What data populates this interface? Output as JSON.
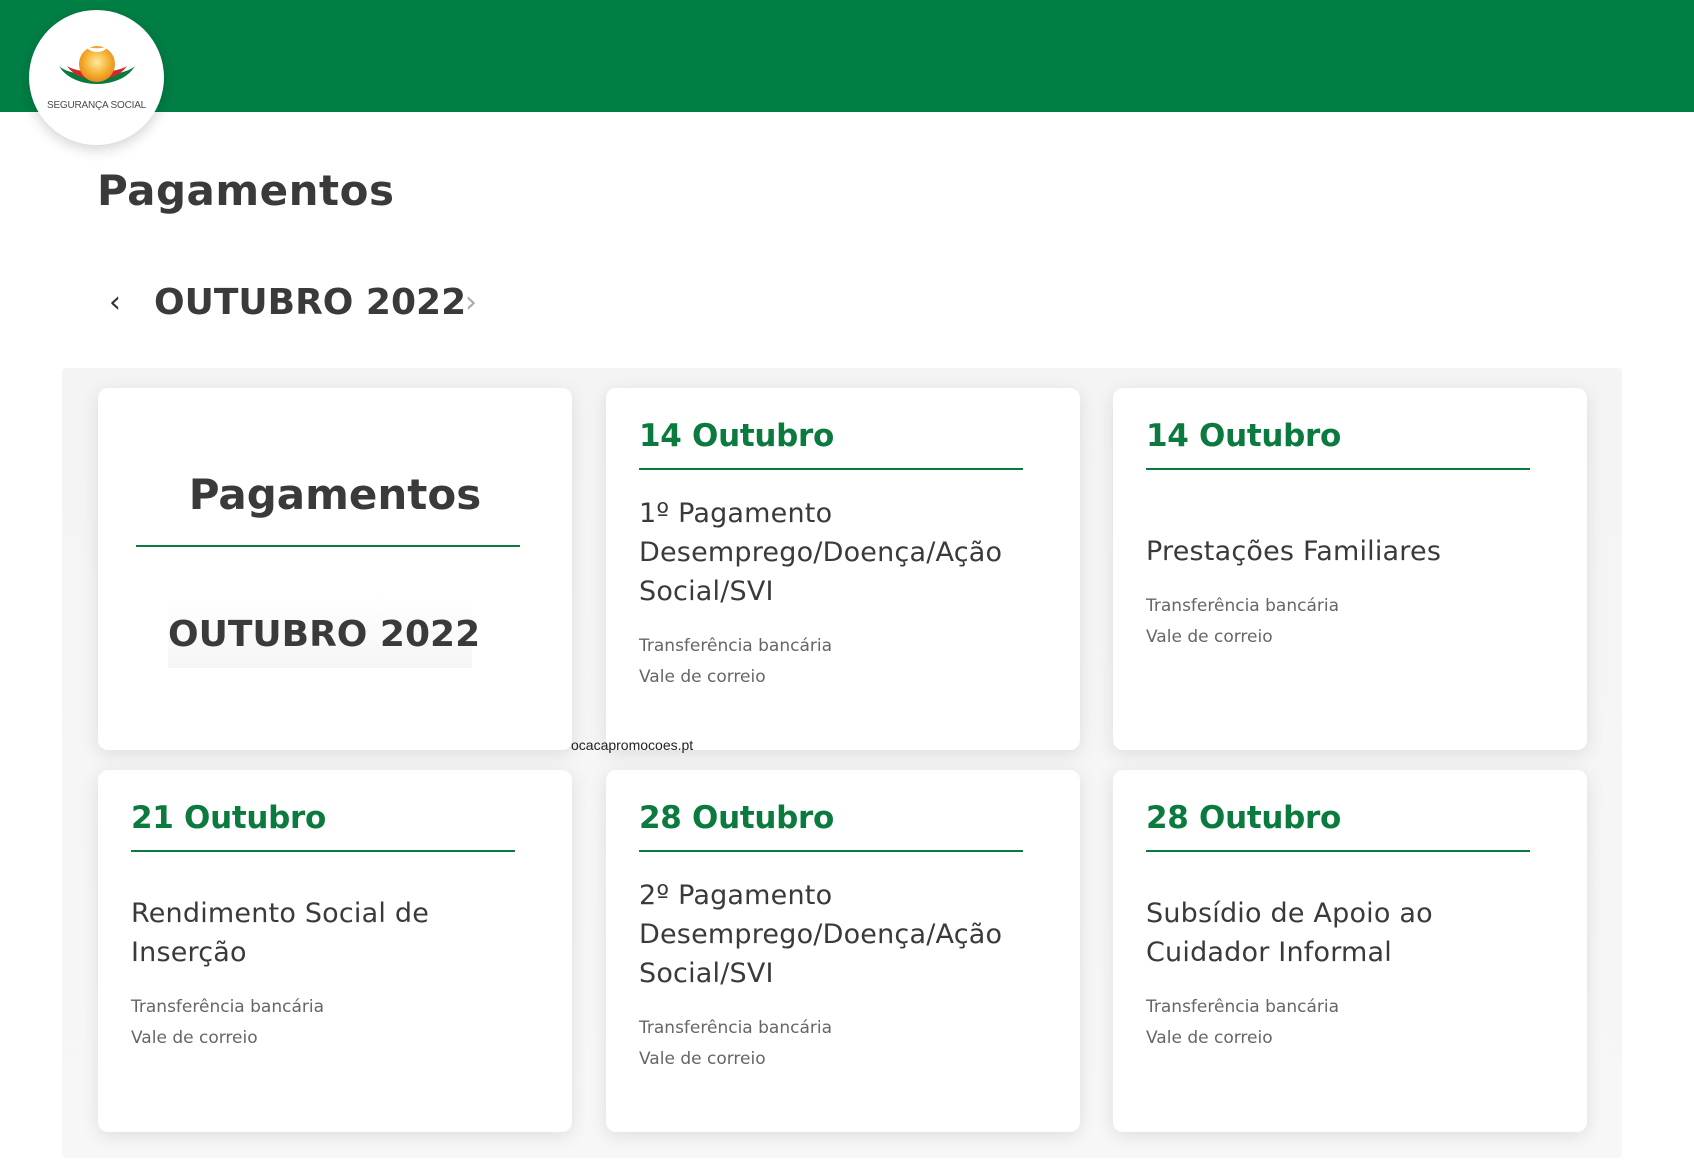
{
  "header": {
    "logo_text": "SEGURANÇA SOCIAL",
    "brand_color": "#007f45"
  },
  "page": {
    "title": "Pagamentos"
  },
  "month_nav": {
    "label": "OUTUBRO 2022",
    "prev_icon": "chevron-left-icon",
    "next_icon": "chevron-right-icon"
  },
  "intro_card": {
    "title": "Pagamentos",
    "month": "OUTUBRO 2022"
  },
  "cards": [
    {
      "date": "14 Outubro",
      "title": "1º Pagamento Desemprego/Doença/Ação Social/SVI",
      "methods": [
        "Transferência bancária",
        "Vale de correio"
      ]
    },
    {
      "date": "14 Outubro",
      "title": "Prestações Familiares",
      "methods": [
        "Transferência bancária",
        "Vale de correio"
      ]
    },
    {
      "date": "21 Outubro",
      "title": "Rendimento Social de Inserção",
      "methods": [
        "Transferência bancária",
        "Vale de correio"
      ]
    },
    {
      "date": "28 Outubro",
      "title": "2º Pagamento Desemprego/Doença/Ação Social/SVI",
      "methods": [
        "Transferência bancária",
        "Vale de correio"
      ]
    },
    {
      "date": "28 Outubro",
      "title": "Subsídio de Apoio ao Cuidador Informal",
      "methods": [
        "Transferência bancária",
        "Vale de correio"
      ]
    }
  ],
  "watermark": "ocacapromocoes.pt",
  "colors": {
    "accent_green": "#0b7a3e",
    "text_dark": "#3a3a3a",
    "text_muted": "#666666"
  }
}
